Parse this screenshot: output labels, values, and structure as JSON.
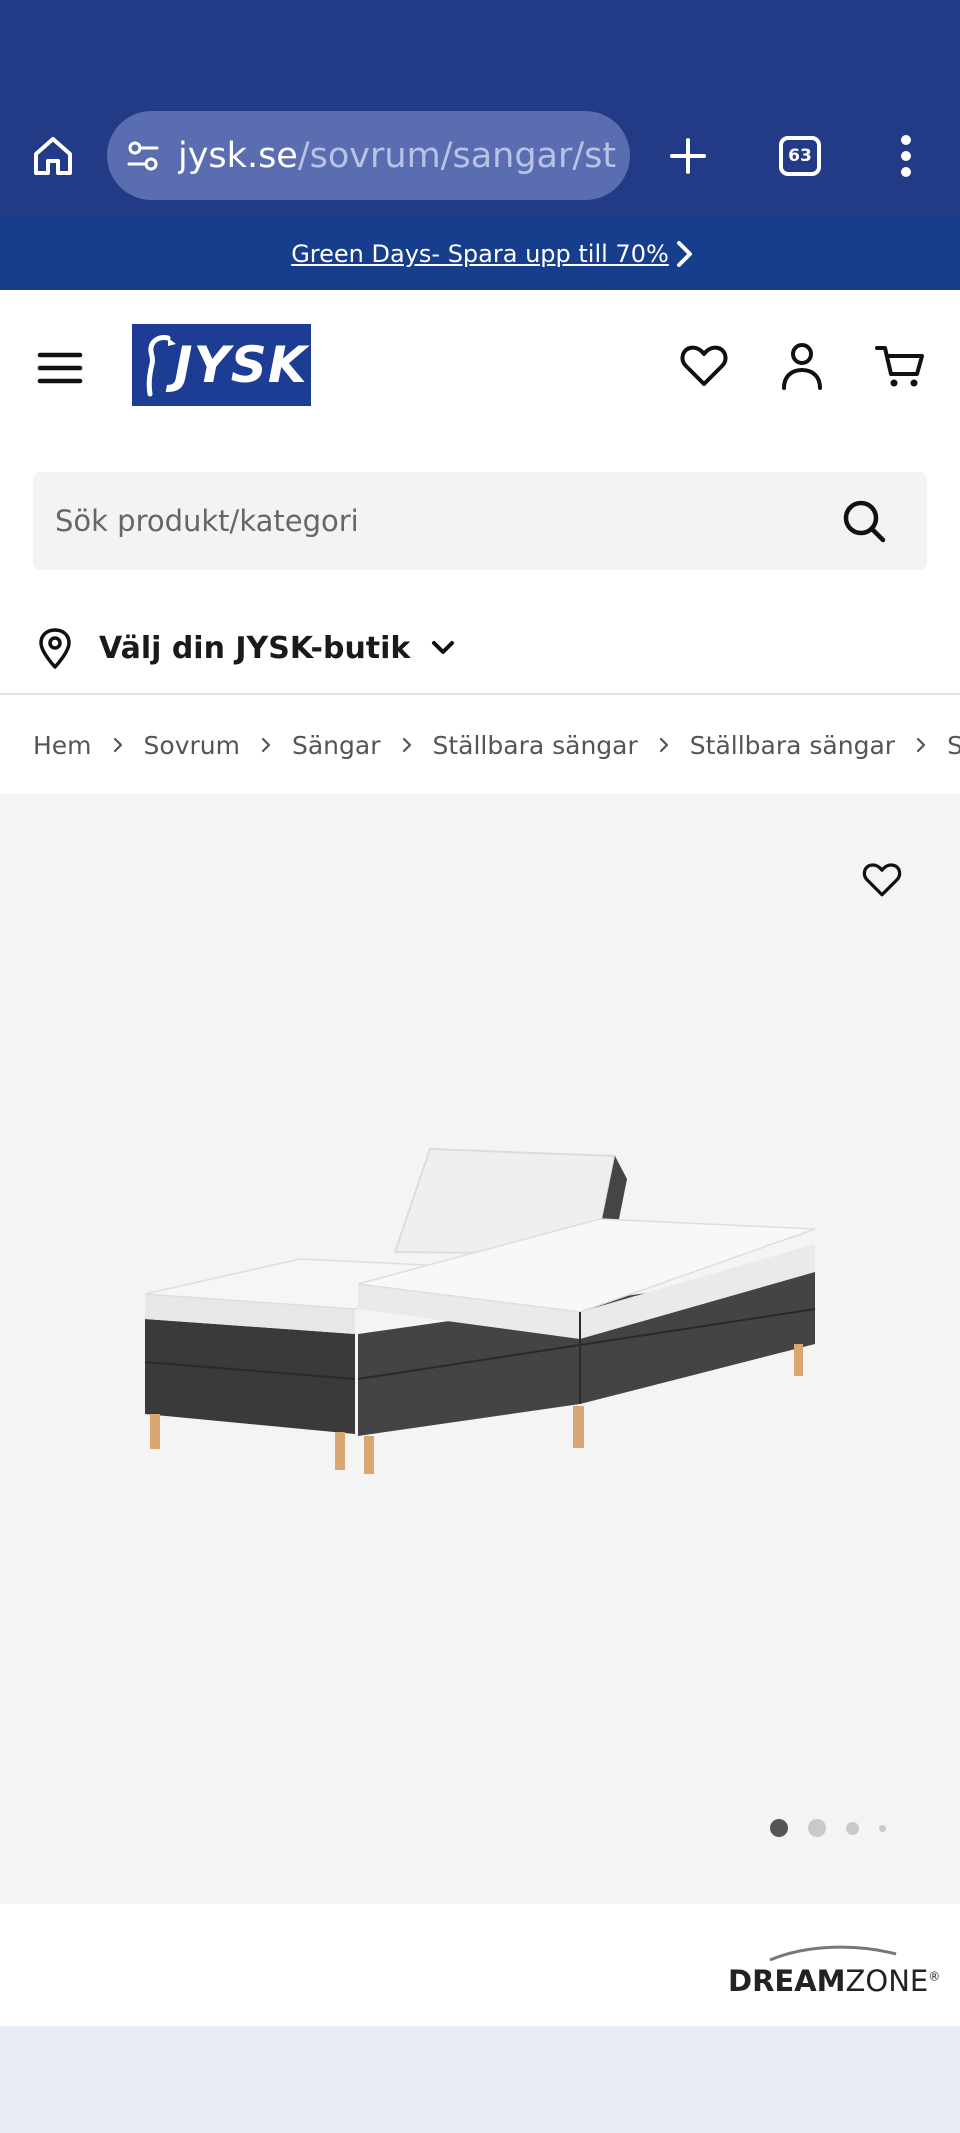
{
  "browser": {
    "url_host": "jysk.se",
    "url_path": "/sovrum/sangar/stallb",
    "tab_count": "63"
  },
  "promo": {
    "text": "Green Days- Spara upp till 70%"
  },
  "header": {
    "logo_text": "JYSK"
  },
  "search": {
    "placeholder": "Sök produkt/kategori"
  },
  "store": {
    "label": "Välj din JYSK-butik"
  },
  "breadcrumb": {
    "items": [
      "Hem",
      "Sovrum",
      "Sängar",
      "Ställbara sängar",
      "Ställbara sängar",
      "S"
    ]
  },
  "gallery": {
    "slide_count": 4,
    "active_slide": 1
  },
  "brand": {
    "name_bold": "DREAM",
    "name_regular": "ZONE",
    "mark": "®"
  },
  "colors": {
    "chrome_bg": "#233a87",
    "promo_bg": "#163e8c",
    "brand_blue": "#1d3d95",
    "gallery_bg": "#f4f4f4"
  }
}
